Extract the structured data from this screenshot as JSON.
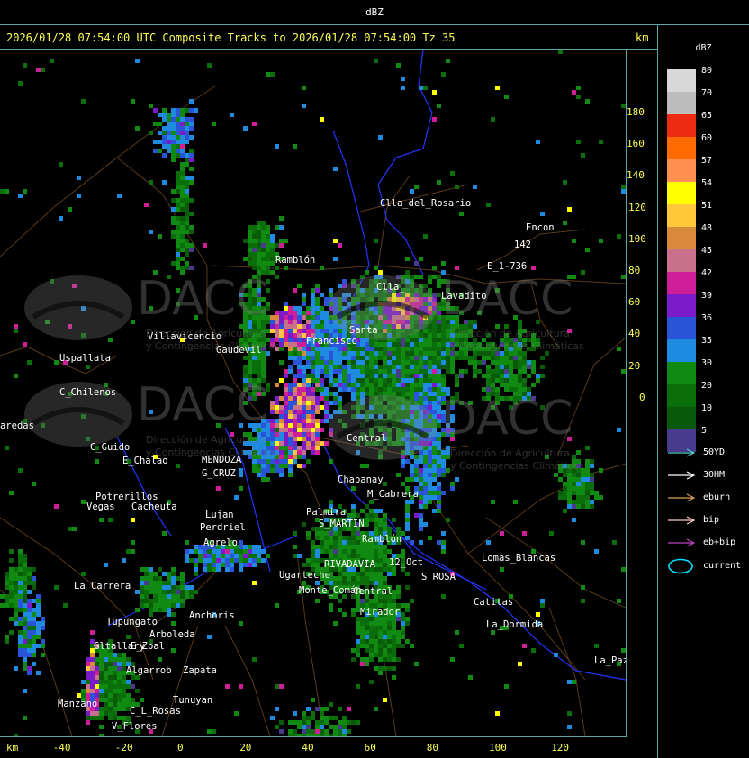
{
  "window": {
    "title": "dBZ"
  },
  "header": {
    "title": "2026/01/28 07:54:00 UTC Composite Tracks to 2026/01/28 07:54:00 Tz 35",
    "unit": "km"
  },
  "axes": {
    "x_unit": "km",
    "x_ticks": [
      "-40",
      "-20",
      "0",
      "20",
      "40",
      "60",
      "80",
      "100",
      "120"
    ],
    "y_ticks": [
      "180",
      "160",
      "140",
      "120",
      "100",
      "80",
      "60",
      "40",
      "20",
      "0"
    ]
  },
  "legend": {
    "title": "dBZ",
    "scale": [
      {
        "label": "80",
        "color": "#d8d8d8"
      },
      {
        "label": "70",
        "color": "#bcbcbc"
      },
      {
        "label": "65",
        "color": "#ee2a12"
      },
      {
        "label": "60",
        "color": "#ff6a00"
      },
      {
        "label": "57",
        "color": "#ff9050"
      },
      {
        "label": "54",
        "color": "#ffff00"
      },
      {
        "label": "51",
        "color": "#ffc83a"
      },
      {
        "label": "48",
        "color": "#d8893a"
      },
      {
        "label": "45",
        "color": "#c8708c"
      },
      {
        "label": "42",
        "color": "#d01e98"
      },
      {
        "label": "39",
        "color": "#7a1ac8"
      },
      {
        "label": "36",
        "color": "#2a54d8"
      },
      {
        "label": "35",
        "color": "#1e8ae0"
      },
      {
        "label": "30",
        "color": "#108a10"
      },
      {
        "label": "20",
        "color": "#0a6e0a"
      },
      {
        "label": "10",
        "color": "#0a5a0a"
      },
      {
        "label": "5",
        "color": "#483a8c"
      }
    ],
    "tracks": [
      {
        "label": "50YD",
        "color": "#55cccc"
      },
      {
        "label": "30HM",
        "color": "#ffffff"
      },
      {
        "label": "eburn",
        "color": "#d8a060"
      },
      {
        "label": "bip",
        "color": "#ffc8c8"
      },
      {
        "label": "eb+bip",
        "color": "#c040c0"
      }
    ],
    "current": {
      "label": "current",
      "color": "#00e0ff"
    }
  },
  "watermarks": {
    "logo": "DACC",
    "line1": "Dirección de Agricultura",
    "line2": "y Contingencias Climáticas"
  },
  "places": [
    "Clla_del_Rosario",
    "Encon",
    "Ramblón",
    "E_1-736",
    "Clla_",
    "Lavadito",
    "Villavicencio",
    "Uspallata",
    "Gaudevil",
    "Francisco",
    "Santa",
    "C_Chilenos",
    "aredas",
    "C_Guido",
    "E_Chalao",
    "MENDOZA",
    "G_CRUZ",
    "Central",
    "Chapanay",
    "Potrerillos",
    "Vegas",
    "Cacheuta",
    "Lujan",
    "Perdriel",
    "Agrelo",
    "S_MARTIN",
    "Ramblón",
    "Lomas_Blancas",
    "RIVADAVIA",
    "12_Oct",
    "Ugarteche",
    "La_Carrera",
    "Catitas",
    "Tupungato",
    "La_Dormida",
    "Anchoris",
    "Arboleda",
    "Gltallary",
    "E_Zpal",
    "La_Paz",
    "Algarrob",
    "Zapata",
    "Tunuyan",
    "C_L_Rosas",
    "Manzano",
    "V_Flores",
    "142",
    "Central",
    "Mirador",
    "Monte_Comán",
    "S_ROSA",
    "Palmira",
    "M_Cabrera"
  ]
}
